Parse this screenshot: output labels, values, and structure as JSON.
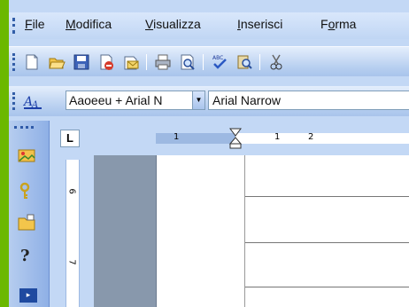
{
  "menu": {
    "items": [
      "File",
      "Modifica",
      "Visualizza",
      "Inserisci",
      "Forma"
    ],
    "underline": [
      "F",
      "M",
      "V",
      "I",
      "o"
    ]
  },
  "toolbar": {
    "icons": [
      "new-document-icon",
      "open-folder-icon",
      "save-icon",
      "permission-icon",
      "email-icon",
      "print-icon",
      "print-preview-icon",
      "spelling-icon",
      "research-icon",
      "cut-icon"
    ]
  },
  "format": {
    "style_value": "Aaoeeu + Arial N",
    "font_value": "Arial Narrow",
    "style_icon": "styles-formatting-icon"
  },
  "leftpane": {
    "icons": [
      "add-clip-icon",
      "key-icon",
      "folder-icon",
      "help-icon"
    ],
    "more": "more-icon"
  },
  "ruler": {
    "tab_selector": "L",
    "numbers": [
      "1",
      "1",
      "2"
    ],
    "vertical_numbers": [
      "6",
      "7"
    ]
  },
  "colors": {
    "background": "#6bb800",
    "toolbar": "#c3d8f5"
  }
}
